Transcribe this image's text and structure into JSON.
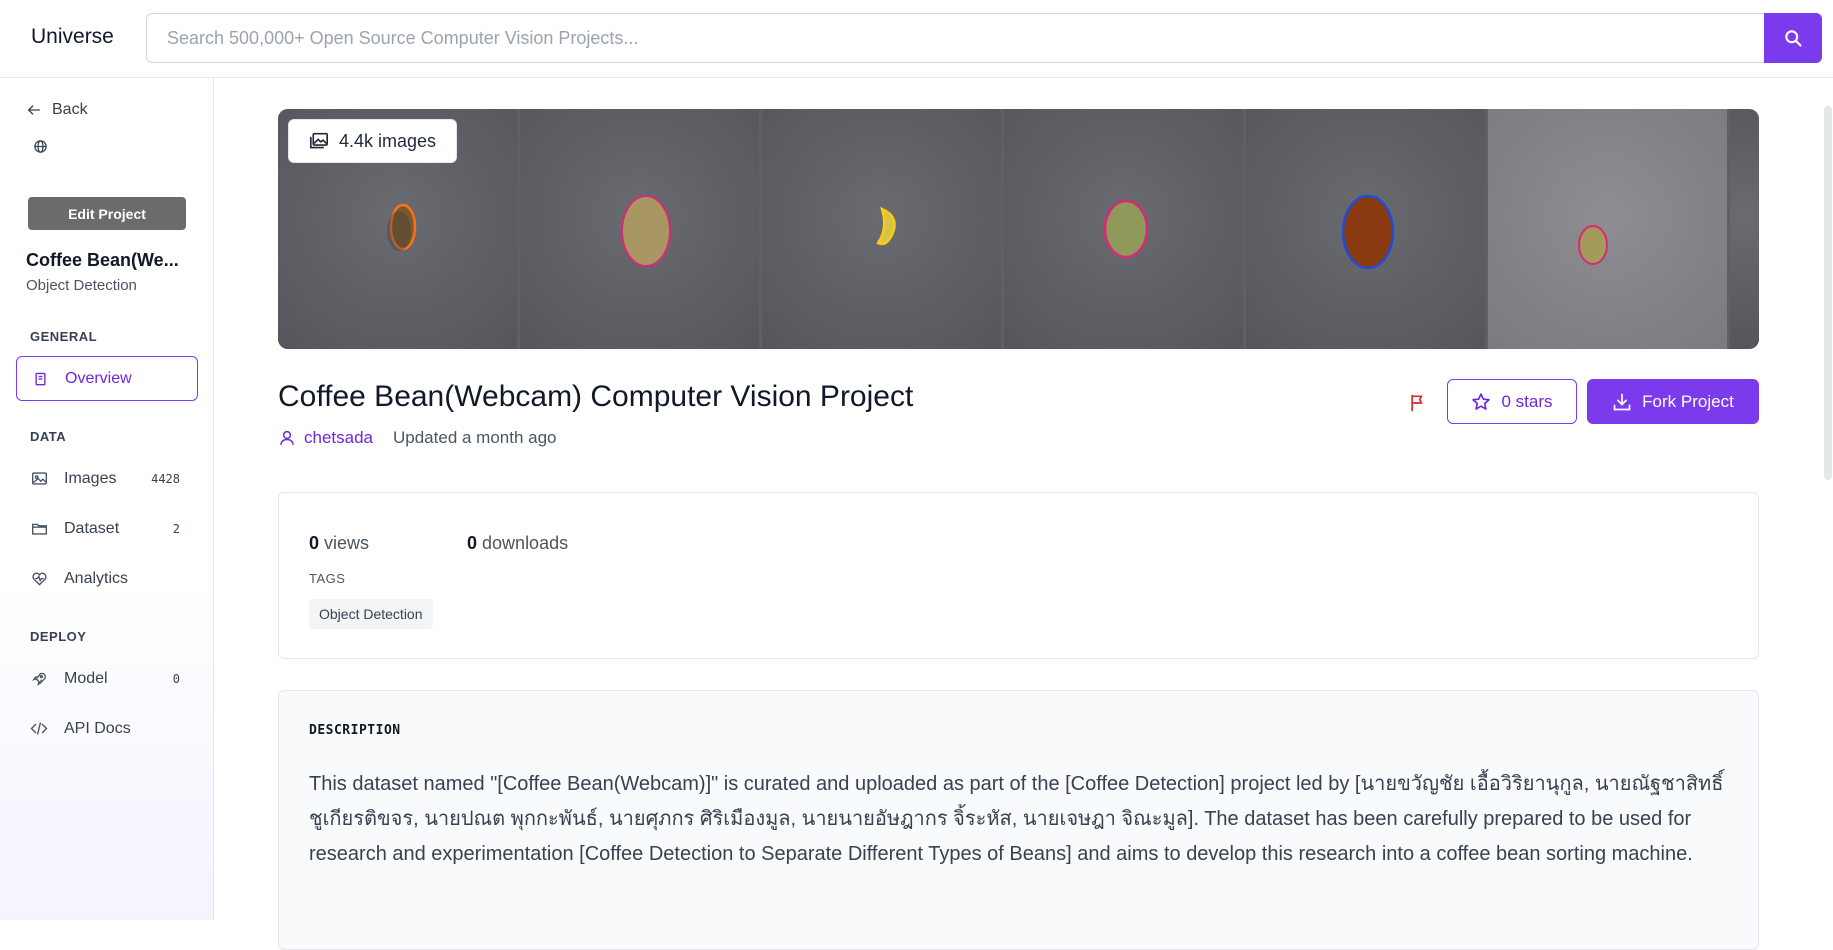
{
  "header": {
    "brand": "Universe",
    "search_placeholder": "Search 500,000+ Open Source Computer Vision Projects..."
  },
  "sidebar": {
    "back_label": "Back",
    "edit_label": "Edit Project",
    "project_name": "Coffee Bean(We...",
    "project_type": "Object Detection",
    "sections": {
      "general": "GENERAL",
      "data": "DATA",
      "deploy": "DEPLOY"
    },
    "items": {
      "overview": {
        "label": "Overview"
      },
      "images": {
        "label": "Images",
        "count": "4428"
      },
      "dataset": {
        "label": "Dataset",
        "count": "2"
      },
      "analytics": {
        "label": "Analytics"
      },
      "model": {
        "label": "Model",
        "count": "0"
      },
      "api_docs": {
        "label": "API Docs"
      }
    }
  },
  "project": {
    "images_badge": "4.4k images",
    "title": "Coffee Bean(Webcam) Computer Vision Project",
    "author": "chetsada",
    "updated": "Updated a month ago",
    "stars_label": "0 stars",
    "fork_label": "Fork Project",
    "views_count": "0",
    "views_label": "views",
    "downloads_count": "0",
    "downloads_label": "downloads",
    "tags_label": "TAGS",
    "tags": [
      "Object Detection"
    ],
    "description_label": "DESCRIPTION",
    "description": "This dataset named \"[Coffee Bean(Webcam)]\" is curated and uploaded as part of the [Coffee Detection] project led by [นายขวัญชัย เอื้อวิริยานุกูล, นายณัฐชาสิทธิ์ ชูเกียรติขจร, นายปณต พุกกะพันธ์, นายศุภกร ศิริเมืองมูล, นายนายอัษฎากร จิ้ระหัส, นายเจษฎา จิณะมูล]. The dataset has been carefully prepared to be used for research and experimentation [Coffee Detection to Separate Different Types of Beans] and aims to develop this research into a coffee bean sorting machine."
  },
  "colors": {
    "accent": "#7c3aed",
    "accent_text": "#6d28d9",
    "flag": "#dc2626",
    "bean_outline_1": "#f97316",
    "bean_outline_2": "#db2777",
    "bean_outline_3": "#facc15",
    "bean_outline_5": "#1d4ed8"
  }
}
